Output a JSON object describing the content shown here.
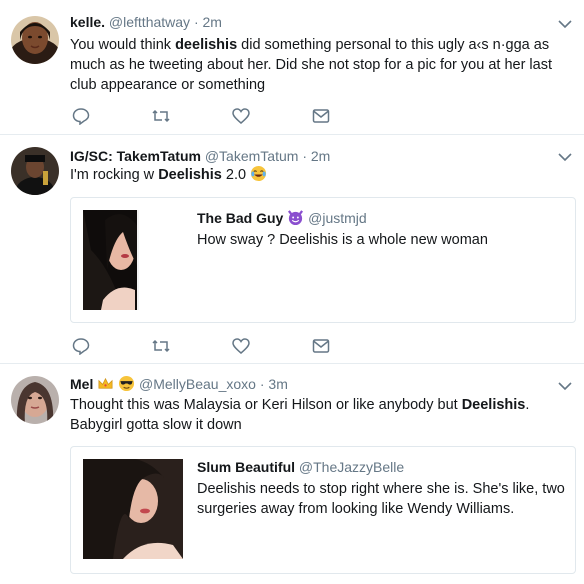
{
  "colors": {
    "text": "#14171a",
    "muted": "#657786",
    "border": "#e6ecf0",
    "icon": "#657786"
  },
  "tweets": [
    {
      "name": "kelle.",
      "handle": "@leftthatway",
      "separator": "·",
      "time": "2m",
      "text_before": "You would think ",
      "text_bold": "deelishis",
      "text_after": " did something personal to this ugly a‹s n·gga as much as he tweeting about her. Did she not stop for a pic for you at her last club appearance or something"
    },
    {
      "name": "IG/SC: TakemTatum",
      "handle": "@TakemTatum",
      "separator": "·",
      "time": "2m",
      "text_before": "I'm rocking w ",
      "text_bold": "Deelishis",
      "text_after": " 2.0",
      "emoji_icon": "tears-of-joy-emoji-icon",
      "quote": {
        "name": "The Bad Guy",
        "handle": "@justmjd",
        "name_emoji_icon": "smiling-devil-emoji-icon",
        "text": "How sway ? Deelishis is a whole new woman"
      }
    },
    {
      "name": "Mel",
      "handle": "@MellyBeau_xoxo",
      "separator": "·",
      "time": "3m",
      "name_emoji_icons": [
        "crown-emoji-icon",
        "sunglasses-emoji-icon"
      ],
      "text_before": "Thought this was Malaysia or Keri Hilson or like anybody but ",
      "text_bold": "Deelishis",
      "text_after": ". Babygirl gotta slow it down",
      "quote": {
        "name": "Slum Beautiful",
        "handle": "@TheJazzyBelle",
        "text": "Deelishis needs to stop right where she is. She's like, two surgeries away from looking like Wendy Williams."
      }
    }
  ]
}
